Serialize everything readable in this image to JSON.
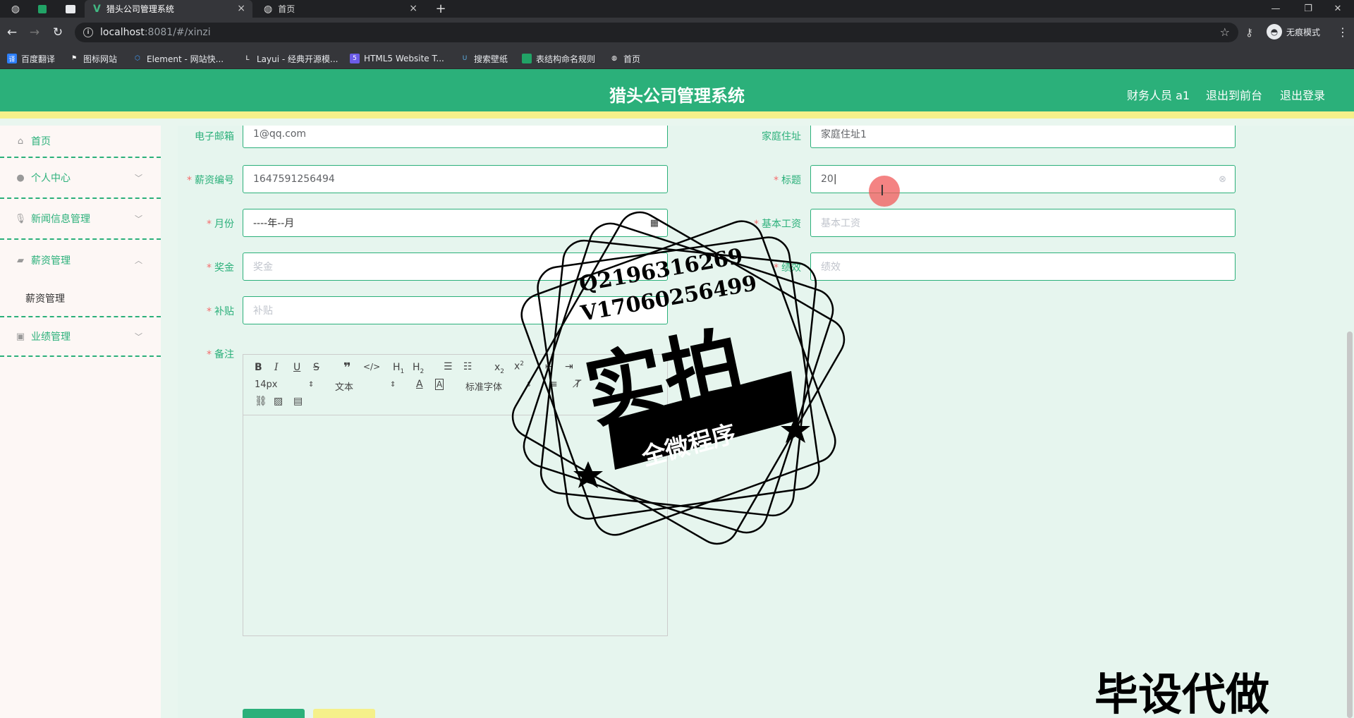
{
  "browser": {
    "tabs": [
      {
        "title": "猎头公司管理系统",
        "active": true
      },
      {
        "title": "首页",
        "active": false
      }
    ],
    "url_host": "localhost",
    "url_rest": ":8081/#/xinzi",
    "incognito_label": "无痕模式",
    "bookmarks": [
      "百度翻译",
      "图标网站",
      "Element - 网站快...",
      "Layui - 经典开源模...",
      "HTML5 Website T...",
      "搜索壁纸",
      "表结构命名规则",
      "首页"
    ]
  },
  "header": {
    "title": "猎头公司管理系统",
    "user": "财务人员 a1",
    "to_front": "退出到前台",
    "logout": "退出登录"
  },
  "sidebar": {
    "items": [
      {
        "label": "首页",
        "icon": "home-icon"
      },
      {
        "label": "个人中心",
        "icon": "user-icon"
      },
      {
        "label": "新闻信息管理",
        "icon": "microphone-icon"
      },
      {
        "label": "薪资管理",
        "icon": "briefcase-icon"
      },
      {
        "label": "业绩管理",
        "icon": "clipboard-icon"
      }
    ],
    "sub_item": "薪资管理"
  },
  "form": {
    "email": {
      "label": "电子邮箱",
      "value": "1@qq.com"
    },
    "address": {
      "label": "家庭住址",
      "value": "家庭住址1"
    },
    "salary_no": {
      "label": "薪资编号",
      "value": "1647591256494"
    },
    "title": {
      "label": "标题",
      "value": "20"
    },
    "month": {
      "label": "月份",
      "value": "----年--月"
    },
    "base_salary": {
      "label": "基本工资",
      "placeholder": "基本工资"
    },
    "bonus": {
      "label": "奖金",
      "placeholder": "奖金"
    },
    "merit": {
      "label": "绩效",
      "placeholder": "绩效"
    },
    "subsidy": {
      "label": "补贴",
      "placeholder": "补贴"
    },
    "remark": {
      "label": "备注"
    }
  },
  "editor": {
    "font_size": "14px",
    "block_type": "文本",
    "font_family": "标准字体"
  },
  "watermark": {
    "line1": "Q2196316269",
    "line2": "V17060256499",
    "big": "实拍",
    "banner": "全微程序",
    "bottom": "毕设代做"
  }
}
